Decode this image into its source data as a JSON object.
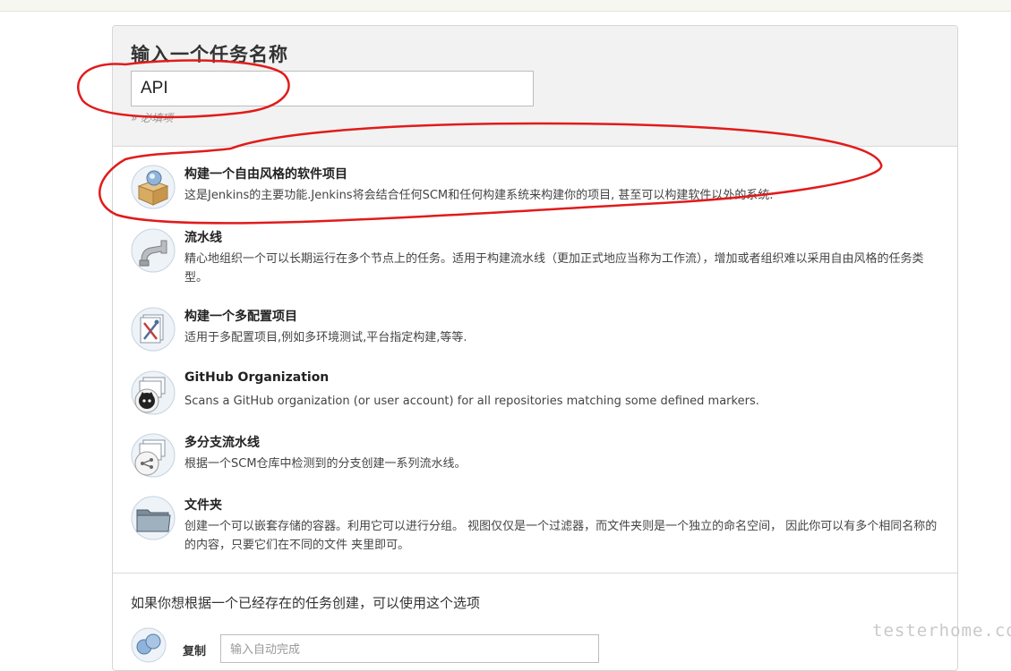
{
  "new_item": {
    "title": "输入一个任务名称",
    "name_value": "API",
    "required_hint": "» 必填项"
  },
  "items": [
    {
      "title": "构建一个自由风格的软件项目",
      "desc": "这是Jenkins的主要功能.Jenkins将会结合任何SCM和任何构建系统来构建你的项目, 甚至可以构建软件以外的系统.",
      "icon": "freestyle-project-icon"
    },
    {
      "title": "流水线",
      "desc": "精心地组织一个可以长期运行在多个节点上的任务。适用于构建流水线（更加正式地应当称为工作流），增加或者组织难以采用自由风格的任务类型。",
      "icon": "pipeline-icon"
    },
    {
      "title": "构建一个多配置项目",
      "desc": "适用于多配置项目,例如多环境测试,平台指定构建,等等.",
      "icon": "multi-config-icon"
    },
    {
      "title": "GitHub Organization",
      "desc": "Scans a GitHub organization (or user account) for all repositories matching some defined markers.",
      "icon": "github-icon"
    },
    {
      "title": "多分支流水线",
      "desc": "根据一个SCM仓库中检测到的分支创建一系列流水线。",
      "icon": "multibranch-icon"
    },
    {
      "title": "文件夹",
      "desc": "创建一个可以嵌套存储的容器。利用它可以进行分组。 视图仅仅是一个过滤器，而文件夹则是一个独立的命名空间， 因此你可以有多个相同名称的的内容，只要它们在不同的文件 夹里即可。",
      "icon": "folder-icon"
    }
  ],
  "copy": {
    "title": "如果你想根据一个已经存在的任务创建，可以使用这个选项",
    "label": "复制",
    "placeholder": "输入自动完成"
  },
  "watermark": "testerhome.com",
  "colors": {
    "annotation_red": "#e11b1b",
    "panel_header_bg": "#f2f2f2"
  }
}
